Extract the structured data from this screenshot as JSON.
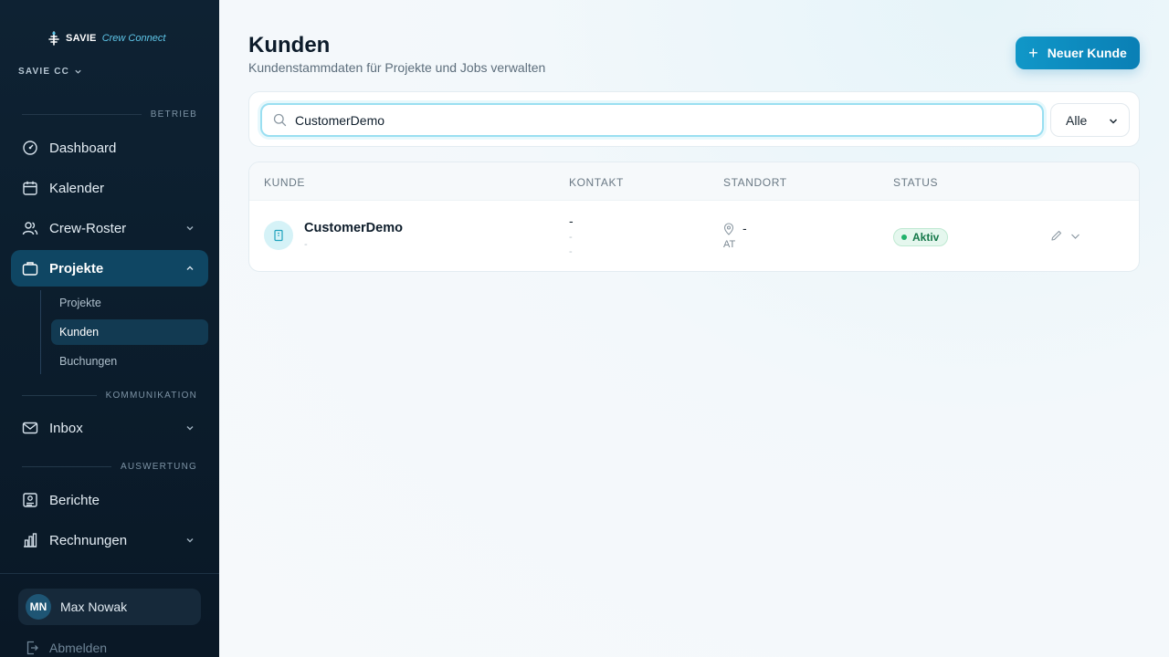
{
  "app": {
    "brand": "SAVIE",
    "product": "Crew Connect",
    "workspace": "SAVIE CC"
  },
  "sidebar": {
    "sections": {
      "betrieb": "BETRIEB",
      "kommunikation": "KOMMUNIKATION",
      "auswertung": "AUSWERTUNG"
    },
    "items": [
      {
        "label": "Dashboard",
        "icon": "dashboard-icon"
      },
      {
        "label": "Kalender",
        "icon": "calendar-icon"
      },
      {
        "label": "Crew-Roster",
        "icon": "users-icon",
        "expandable": true
      },
      {
        "label": "Projekte",
        "icon": "briefcase-icon",
        "expandable": true,
        "active": true
      },
      {
        "label": "Inbox",
        "icon": "mail-icon",
        "expandable": true
      },
      {
        "label": "Berichte",
        "icon": "report-icon"
      },
      {
        "label": "Rechnungen",
        "icon": "bar-chart-icon",
        "expandable": true
      }
    ],
    "projekte_sub": [
      {
        "label": "Projekte"
      },
      {
        "label": "Kunden",
        "active": true
      },
      {
        "label": "Buchungen"
      }
    ],
    "user": {
      "initials": "MN",
      "name": "Max Nowak"
    },
    "logout_label": "Abmelden"
  },
  "main": {
    "title": "Kunden",
    "subtitle": "Kundenstammdaten für Projekte und Jobs verwalten",
    "new_button_label": "Neuer Kunde",
    "search": {
      "value": "CustomerDemo"
    },
    "status_filter": {
      "selected": "Alle"
    },
    "table": {
      "columns": [
        "KUNDE",
        "KONTAKT",
        "STANDORT",
        "STATUS"
      ],
      "rows": [
        {
          "name": "CustomerDemo",
          "sub": "-",
          "contact_main": "-",
          "contact_line2": "-",
          "contact_line3": "-",
          "location": "-",
          "country": "AT",
          "status": "Aktiv"
        }
      ]
    }
  },
  "colors": {
    "sidebar_bg": "#0e2233",
    "active_nav": "#0f4663",
    "accent": "#0a8fc4",
    "status_active": "#16784a"
  }
}
